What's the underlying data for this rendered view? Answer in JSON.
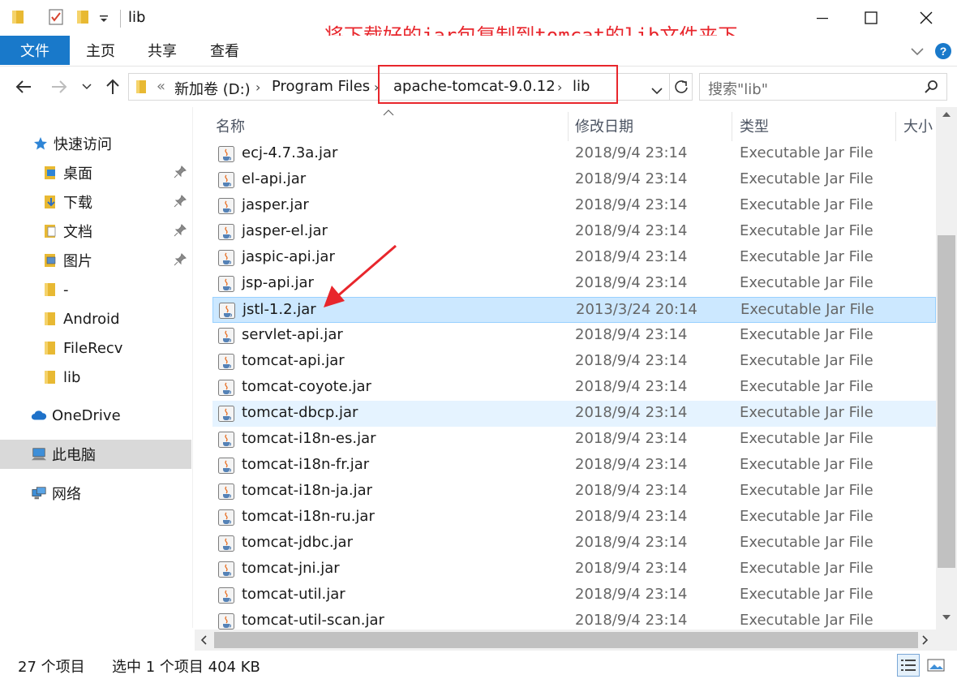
{
  "window": {
    "title": "lib",
    "annotation": "将下载好的jar包复制到tomcat的lib文件夹下"
  },
  "ribbon": {
    "tabs": [
      "文件",
      "主页",
      "共享",
      "查看"
    ]
  },
  "address": {
    "overflow": "«",
    "crumbs": [
      "新加卷 (D:)",
      "Program Files",
      "apache-tomcat-9.0.12",
      "lib"
    ]
  },
  "search": {
    "placeholder": "搜索\"lib\""
  },
  "sidebar": {
    "quick_access": "快速访问",
    "pinned": [
      "桌面",
      "下载",
      "文档",
      "图片"
    ],
    "folders": [
      "-",
      "Android",
      "FileRecv",
      "lib"
    ],
    "onedrive": "OneDrive",
    "this_pc": "此电脑",
    "network": "网络"
  },
  "columns": {
    "name": "名称",
    "date": "修改日期",
    "type": "类型",
    "size": "大小"
  },
  "files": [
    {
      "name": "ecj-4.7.3a.jar",
      "date": "2018/9/4 23:14",
      "type": "Executable Jar File"
    },
    {
      "name": "el-api.jar",
      "date": "2018/9/4 23:14",
      "type": "Executable Jar File"
    },
    {
      "name": "jasper.jar",
      "date": "2018/9/4 23:14",
      "type": "Executable Jar File"
    },
    {
      "name": "jasper-el.jar",
      "date": "2018/9/4 23:14",
      "type": "Executable Jar File"
    },
    {
      "name": "jaspic-api.jar",
      "date": "2018/9/4 23:14",
      "type": "Executable Jar File"
    },
    {
      "name": "jsp-api.jar",
      "date": "2018/9/4 23:14",
      "type": "Executable Jar File"
    },
    {
      "name": "jstl-1.2.jar",
      "date": "2013/3/24 20:14",
      "type": "Executable Jar File",
      "selected": true
    },
    {
      "name": "servlet-api.jar",
      "date": "2018/9/4 23:14",
      "type": "Executable Jar File"
    },
    {
      "name": "tomcat-api.jar",
      "date": "2018/9/4 23:14",
      "type": "Executable Jar File"
    },
    {
      "name": "tomcat-coyote.jar",
      "date": "2018/9/4 23:14",
      "type": "Executable Jar File"
    },
    {
      "name": "tomcat-dbcp.jar",
      "date": "2018/9/4 23:14",
      "type": "Executable Jar File",
      "hover": true
    },
    {
      "name": "tomcat-i18n-es.jar",
      "date": "2018/9/4 23:14",
      "type": "Executable Jar File"
    },
    {
      "name": "tomcat-i18n-fr.jar",
      "date": "2018/9/4 23:14",
      "type": "Executable Jar File"
    },
    {
      "name": "tomcat-i18n-ja.jar",
      "date": "2018/9/4 23:14",
      "type": "Executable Jar File"
    },
    {
      "name": "tomcat-i18n-ru.jar",
      "date": "2018/9/4 23:14",
      "type": "Executable Jar File"
    },
    {
      "name": "tomcat-jdbc.jar",
      "date": "2018/9/4 23:14",
      "type": "Executable Jar File"
    },
    {
      "name": "tomcat-jni.jar",
      "date": "2018/9/4 23:14",
      "type": "Executable Jar File"
    },
    {
      "name": "tomcat-util.jar",
      "date": "2018/9/4 23:14",
      "type": "Executable Jar File"
    },
    {
      "name": "tomcat-util-scan.jar",
      "date": "2018/9/4 23:14",
      "type": "Executable Jar File"
    }
  ],
  "status": {
    "count": "27 个项目",
    "selection": "选中 1 个项目  404 KB"
  },
  "colors": {
    "accent": "#1979ca",
    "annotation": "#e8262c",
    "selected_row": "#cce8ff",
    "hover_row": "#e5f3ff"
  }
}
